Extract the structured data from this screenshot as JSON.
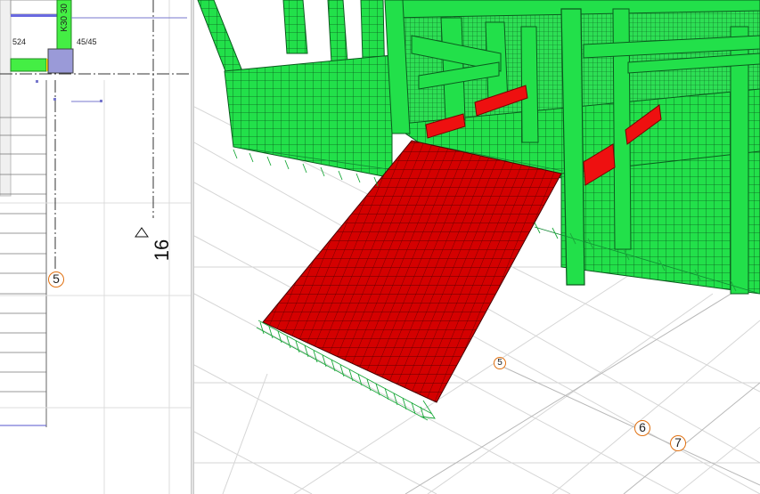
{
  "plan": {
    "grid_label": "5",
    "dimension_label": "16",
    "column_label": "45/45",
    "left_text": "524",
    "beam_label": "K30 30"
  },
  "model": {
    "axis_labels": [
      "5",
      "6",
      "7"
    ]
  },
  "colors": {
    "wall_green": "#22e04a",
    "slab_red": "#d40000",
    "beam_red": "#ee1010",
    "grid_orange": "#e07010"
  }
}
